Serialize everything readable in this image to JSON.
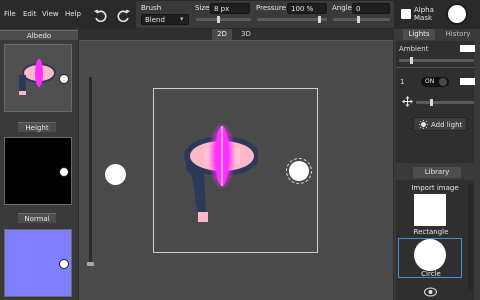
{
  "menu": [
    "File",
    "Edit",
    "View",
    "Help"
  ],
  "toolbar": {
    "brush_label": "Brush",
    "blend_value": "Blend",
    "size_label": "Size",
    "size_value": "8 px",
    "pressure_label": "Pressure",
    "pressure_value": "100 %",
    "angle_label": "Angle",
    "angle_value": "0",
    "alpha_label": "Alpha",
    "mask_label": "Mask"
  },
  "left_panels": {
    "albedo": "Albedo",
    "height": "Height",
    "normal": "Normal"
  },
  "view_tabs": [
    "2D",
    "3D"
  ],
  "right_tabs": {
    "lights": "Lights",
    "history": "History"
  },
  "lights": {
    "ambient_label": "Ambient",
    "light_index": "1",
    "on_label": "ON",
    "add_light": "Add light"
  },
  "library": {
    "title": "Library",
    "import_label": "Import image",
    "items": [
      "Rectangle",
      "Circle"
    ]
  },
  "colors": {
    "background": "#2f2f2f",
    "viewport": "#4a4a4a",
    "accent_selected": "#4a90d9",
    "glow": "#ff30ff",
    "normal_map": "#8080ff",
    "skin": "#ffb8c8",
    "cloth": "#2c3a5a"
  },
  "icons": [
    "undo-icon",
    "redo-icon",
    "move-icon",
    "light-bulb-icon",
    "eye-icon"
  ]
}
